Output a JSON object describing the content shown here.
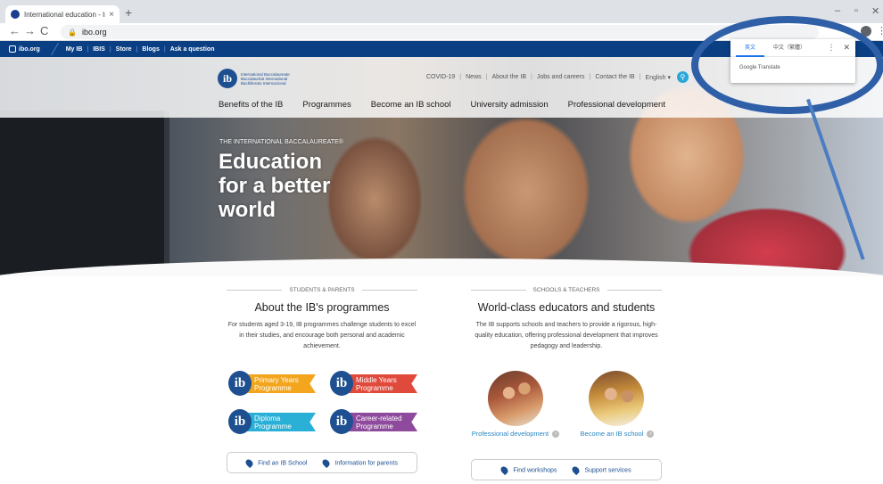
{
  "browser": {
    "tab_title": "International education - Inter",
    "tab_close": "×",
    "new_tab": "+",
    "url": "ibo.org",
    "back": "←",
    "forward": "→",
    "reload": "C",
    "minimize": "–",
    "restore": "▫",
    "close": "✕",
    "menu": "⋮"
  },
  "utility_bar": {
    "site": "ibo.org",
    "links": [
      "My IB",
      "IBIS",
      "Store",
      "Blogs",
      "Ask a question"
    ]
  },
  "header": {
    "logo_mark": "ib",
    "logo_text": [
      "International Baccalaureate",
      "Baccalauréat International",
      "Bachillerato Internacional"
    ],
    "top_links": [
      "COVID-19",
      "News",
      "About the IB",
      "Jobs and careers",
      "Contact the IB"
    ],
    "language": "English ▾",
    "nav": [
      "Benefits of the IB",
      "Programmes",
      "Become an IB school",
      "University admission",
      "Professional development"
    ]
  },
  "hero": {
    "kicker": "THE INTERNATIONAL BACCALAUREATE®",
    "title_lines": [
      "Education",
      "for a better",
      "world"
    ]
  },
  "students": {
    "eyebrow": "STUDENTS & PARENTS",
    "heading": "About the IB's programmes",
    "body": "For students aged 3-19, IB programmes challenge students to excel in their studies, and encourage both personal and academic achievement.",
    "programmes": [
      {
        "line1": "Primary Years",
        "line2": "Programme",
        "color": "#f2a51d"
      },
      {
        "line1": "Middle Years",
        "line2": "Programme",
        "color": "#e04a3c"
      },
      {
        "line1": "Diploma",
        "line2": "Programme",
        "color": "#2ab0d6"
      },
      {
        "line1": "Career-related",
        "line2": "Programme",
        "color": "#8e4b9d"
      }
    ],
    "link1": "Find an IB School",
    "link2": "Information for parents"
  },
  "schools": {
    "eyebrow": "SCHOOLS & TEACHERS",
    "heading": "World-class educators and students",
    "body": "The IB supports schools and teachers to provide a rigorous, high-quality education, offering professional development that improves pedagogy and leadership.",
    "card1": "Professional development",
    "card2": "Become an IB school",
    "link1": "Find workshops",
    "link2": "Support services"
  },
  "translate_popup": {
    "lang_source": "英文",
    "lang_target": "中文（繁體）",
    "brand": "Google Translate",
    "more": "⋮",
    "close": "✕"
  }
}
